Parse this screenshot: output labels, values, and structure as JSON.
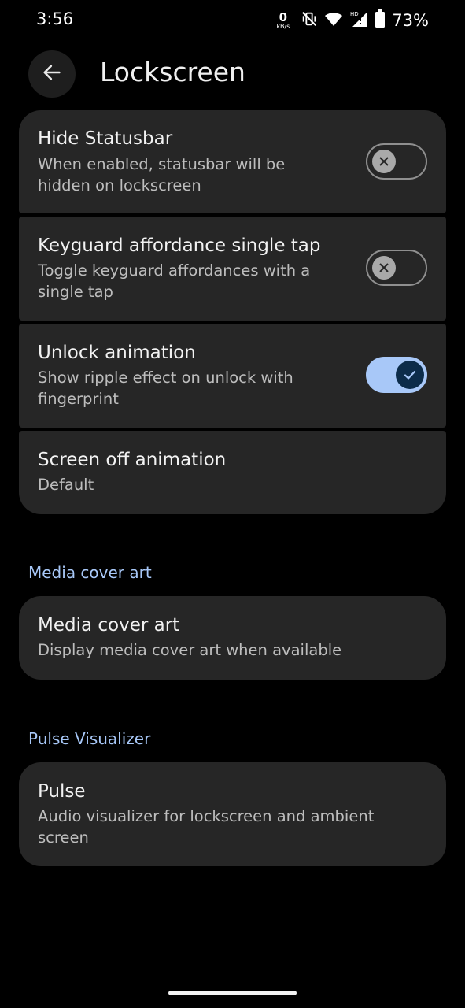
{
  "status_bar": {
    "time": "3:56",
    "net_speed_value": "0",
    "net_speed_unit": "kB/s",
    "battery_percent": "73%",
    "icons": [
      "mute-vibrate-icon",
      "wifi-icon",
      "hd-signal-icon",
      "battery-icon"
    ]
  },
  "header": {
    "title": "Lockscreen",
    "back_icon": "arrow-back-icon"
  },
  "settings": [
    {
      "title": "Hide Statusbar",
      "subtitle": "When enabled, statusbar will be hidden on lockscreen",
      "toggle": "off"
    },
    {
      "title": "Keyguard affordance single tap",
      "subtitle": "Toggle keyguard affordances with a single tap",
      "toggle": "off"
    },
    {
      "title": "Unlock animation",
      "subtitle": "Show ripple effect on unlock with fingerprint",
      "toggle": "on"
    },
    {
      "title": "Screen off animation",
      "subtitle": "Default"
    }
  ],
  "sections": [
    {
      "header": "Media cover art",
      "items": [
        {
          "title": "Media cover art",
          "subtitle": "Display media cover art when available"
        }
      ]
    },
    {
      "header": "Pulse Visualizer",
      "items": [
        {
          "title": "Pulse",
          "subtitle": "Audio visualizer for lockscreen and ambient screen"
        }
      ]
    }
  ],
  "colors": {
    "background": "#000000",
    "card": "#262626",
    "accent": "#a8c8f8",
    "toggle_knob_on": "#0c2c4a"
  }
}
